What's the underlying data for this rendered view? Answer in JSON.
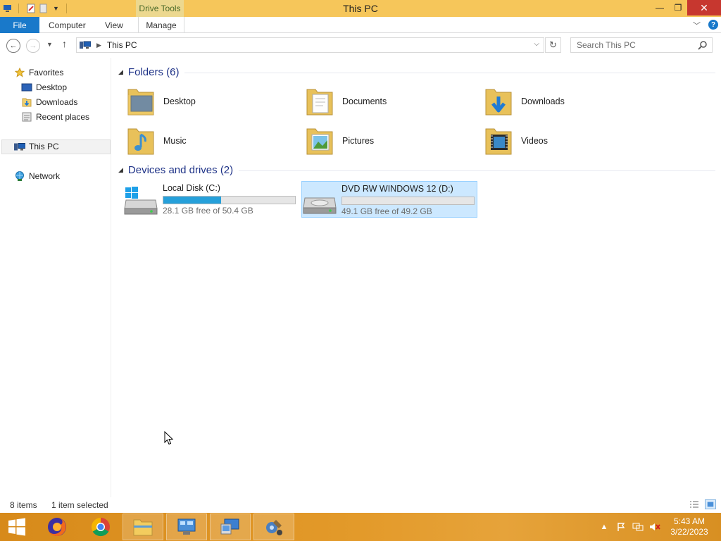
{
  "window": {
    "title": "This PC",
    "context_tab": "Drive Tools",
    "close_glyph": "✕",
    "min_glyph": "—",
    "max_glyph": "❐"
  },
  "ribbon": {
    "tabs": [
      {
        "label": "File",
        "active": true
      },
      {
        "label": "Computer"
      },
      {
        "label": "View"
      },
      {
        "label": "Manage"
      }
    ],
    "help_glyph": "?"
  },
  "address": {
    "path": "This PC",
    "search_placeholder": "Search This PC"
  },
  "nav": {
    "favorites": "Favorites",
    "favorite_items": [
      "Desktop",
      "Downloads",
      "Recent places"
    ],
    "this_pc": "This PC",
    "network": "Network"
  },
  "folders_group": {
    "header": "Folders (6)",
    "items": [
      "Desktop",
      "Documents",
      "Downloads",
      "Music",
      "Pictures",
      "Videos"
    ]
  },
  "drives_group": {
    "header": "Devices and drives (2)",
    "items": [
      {
        "name": "Local Disk (C:)",
        "free_text": "28.1 GB free of 50.4 GB",
        "used_fraction": 0.44,
        "selected": false
      },
      {
        "name": "DVD RW WINDOWS 12 (D:)",
        "free_text": "49.1 GB free of 49.2 GB",
        "used_fraction": 0.0,
        "selected": true
      }
    ]
  },
  "status": {
    "count": "8 items",
    "selection": "1 item selected"
  },
  "taskbar": {
    "apps": [
      "windows-start",
      "firefox",
      "chrome",
      "file-explorer",
      "control-panel",
      "remote-desktop",
      "system-tool"
    ],
    "clock_time": "5:43 AM",
    "clock_date": "3/22/2023"
  },
  "colors": {
    "titlebar": "#f6c65a",
    "file_tab": "#1979ca",
    "group_header": "#1e3287",
    "selection": "#cce8ff",
    "progress": "#26a0da",
    "taskbar": "#e39a2a"
  }
}
